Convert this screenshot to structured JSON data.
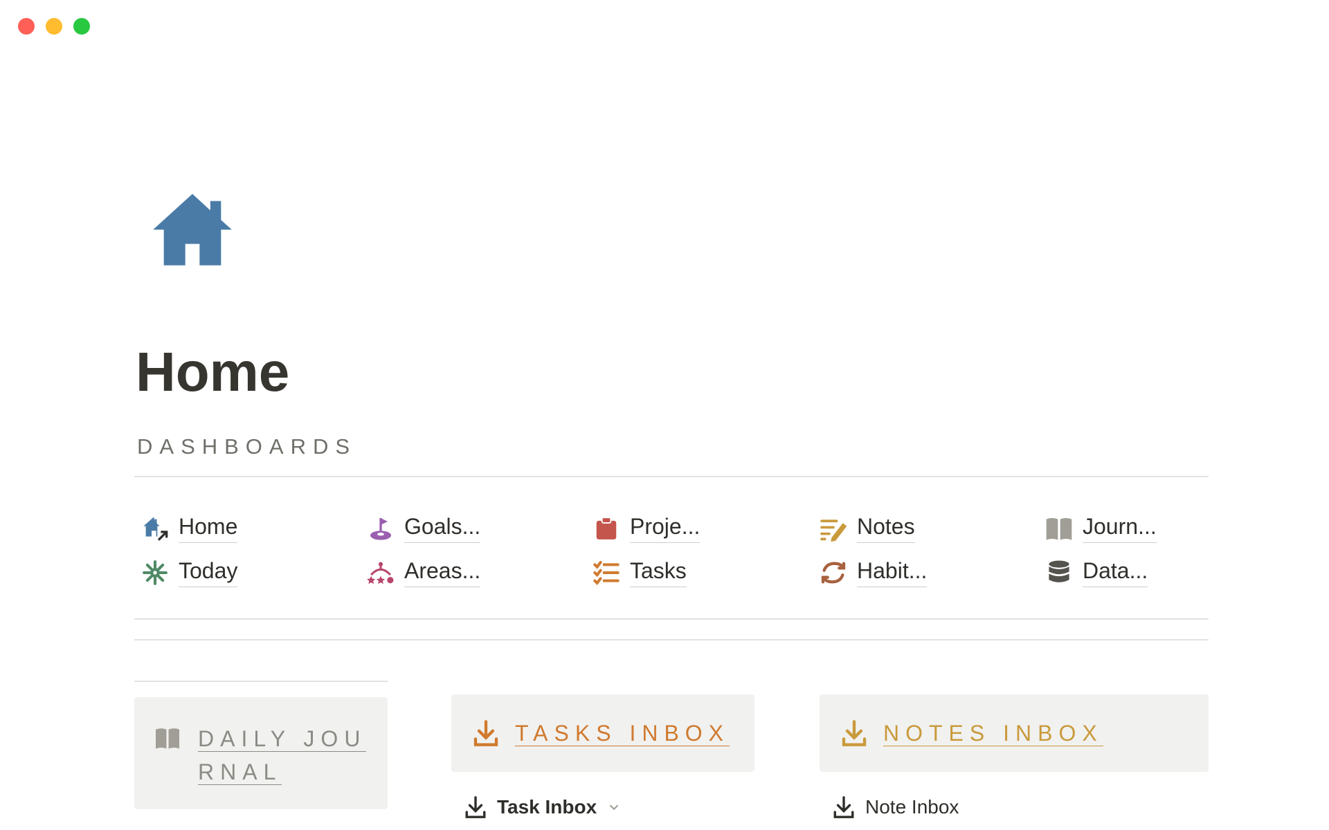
{
  "page": {
    "title": "Home",
    "section_label": "DASHBOARDS"
  },
  "window_controls": {
    "close_color": "#ff5f57",
    "minimize_color": "#febc2e",
    "zoom_color": "#28c840"
  },
  "dashboards": [
    {
      "label": "Home",
      "icon": "home-link-icon",
      "color": "#4a7ba6"
    },
    {
      "label": "Today",
      "icon": "asterisk-icon",
      "color": "#4f8a66"
    },
    {
      "label": "Goals...",
      "icon": "goal-flag-icon",
      "color": "#9b5fb0"
    },
    {
      "label": "Areas...",
      "icon": "areas-icon",
      "color": "#b8466f"
    },
    {
      "label": "Proje...",
      "icon": "clipboard-icon",
      "color": "#c4554d"
    },
    {
      "label": "Tasks",
      "icon": "checklist-icon",
      "color": "#d07a2f"
    },
    {
      "label": "Notes",
      "icon": "note-pencil-icon",
      "color": "#c99a3c"
    },
    {
      "label": "Habit...",
      "icon": "repeat-icon",
      "color": "#a8623f"
    },
    {
      "label": "Journ...",
      "icon": "book-icon",
      "color": "#a09e96"
    },
    {
      "label": "Data...",
      "icon": "database-icon",
      "color": "#55534e"
    }
  ],
  "cards": {
    "daily_journal": {
      "line1": "DAILY JOU",
      "line2": "RNAL",
      "color": "#8b8a85"
    },
    "tasks_inbox": {
      "title": "TASKS INBOX",
      "color": "#d07a2f"
    },
    "notes_inbox": {
      "title": "NOTES INBOX",
      "color": "#c99a3c"
    }
  },
  "links": {
    "task_inbox": "Task Inbox",
    "note_inbox": "Note Inbox"
  }
}
